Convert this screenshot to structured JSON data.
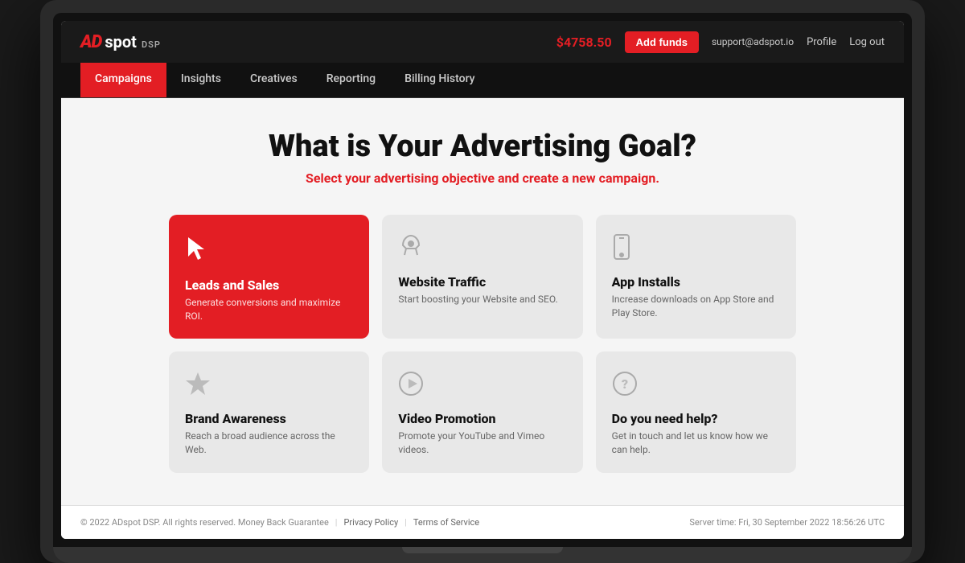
{
  "header": {
    "logo_ad": "AD",
    "logo_spot": "spot",
    "logo_dsp": "DSP",
    "balance": "$4758.50",
    "add_funds_label": "Add funds",
    "support_email": "support@adspot.io",
    "profile_label": "Profile",
    "logout_label": "Log out"
  },
  "nav": {
    "items": [
      {
        "label": "Campaigns",
        "active": true
      },
      {
        "label": "Insights",
        "active": false
      },
      {
        "label": "Creatives",
        "active": false
      },
      {
        "label": "Reporting",
        "active": false
      },
      {
        "label": "Billing History",
        "active": false
      }
    ]
  },
  "main": {
    "title": "What is Your Advertising Goal?",
    "subtitle": "Select your advertising objective and create a new campaign.",
    "cards": [
      {
        "id": "leads-sales",
        "icon": "cursor",
        "title": "Leads and Sales",
        "desc": "Generate conversions and maximize ROI.",
        "active": true
      },
      {
        "id": "website-traffic",
        "icon": "rocket",
        "title": "Website Traffic",
        "desc": "Start boosting your Website and SEO.",
        "active": false
      },
      {
        "id": "app-installs",
        "icon": "phone",
        "title": "App Installs",
        "desc": "Increase downloads on App Store and Play Store.",
        "active": false
      },
      {
        "id": "brand-awareness",
        "icon": "star",
        "title": "Brand Awareness",
        "desc": "Reach a broad audience across the Web.",
        "active": false
      },
      {
        "id": "video-promotion",
        "icon": "play",
        "title": "Video Promotion",
        "desc": "Promote your YouTube and Vimeo videos.",
        "active": false
      },
      {
        "id": "help",
        "icon": "help",
        "title": "Do you need help?",
        "desc": "Get in touch and let us know how we can help.",
        "active": false
      }
    ]
  },
  "footer": {
    "copyright": "© 2022 ADspot DSP. All rights reserved. Money Back Guarantee",
    "privacy_policy": "Privacy Policy",
    "terms_service": "Terms of Service",
    "server_time": "Server time: Fri, 30 September 2022 18:56:26 UTC"
  }
}
